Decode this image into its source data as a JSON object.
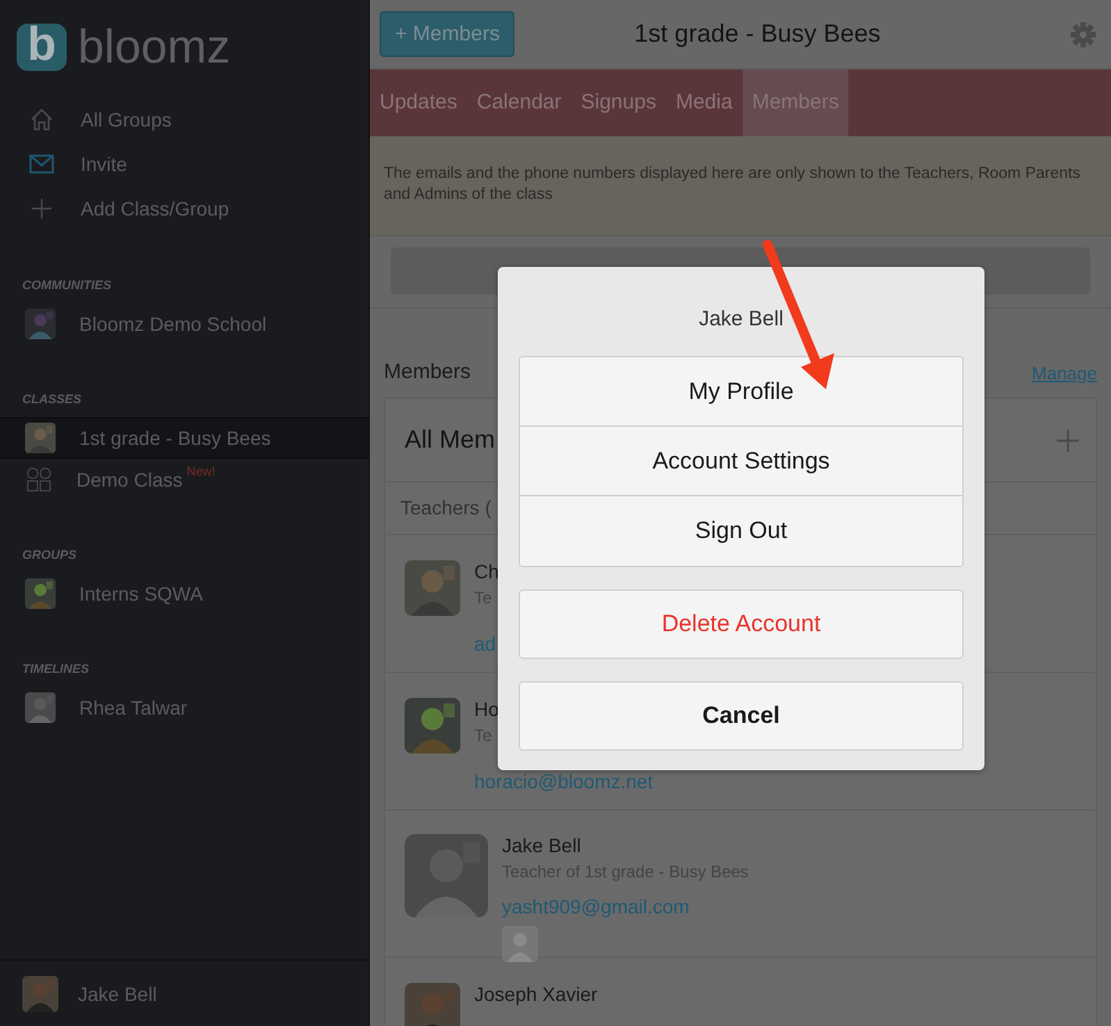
{
  "app": {
    "logo_letter": "b",
    "logo_text": "bloomz"
  },
  "sidebar": {
    "nav": [
      {
        "label": "All Groups"
      },
      {
        "label": "Invite"
      },
      {
        "label": "Add Class/Group"
      }
    ],
    "sections": [
      {
        "heading": "COMMUNITIES",
        "items": [
          {
            "label": "Bloomz Demo School",
            "selected": false
          }
        ]
      },
      {
        "heading": "CLASSES",
        "items": [
          {
            "label": "1st grade - Busy Bees",
            "selected": true
          },
          {
            "label": "Demo Class",
            "badge": "New!",
            "selected": false
          }
        ]
      },
      {
        "heading": "GROUPS",
        "items": [
          {
            "label": "Interns SQWA",
            "selected": false
          }
        ]
      },
      {
        "heading": "TIMELINES",
        "items": [
          {
            "label": "Rhea Talwar",
            "selected": false
          }
        ]
      }
    ],
    "user": {
      "name": "Jake Bell"
    }
  },
  "header": {
    "add_button": "+ Members",
    "title": "1st grade - Busy Bees"
  },
  "tabs": [
    {
      "label": "Updates",
      "selected": false
    },
    {
      "label": "Calendar",
      "selected": false
    },
    {
      "label": "Signups",
      "selected": false
    },
    {
      "label": "Media",
      "selected": false
    },
    {
      "label": "Members",
      "selected": true
    }
  ],
  "notice": "The emails and the phone numbers displayed here are only shown to the Teachers, Room Parents and Admins of the class",
  "members": {
    "heading": "Members",
    "manage": "Manage",
    "card_title": "All Mem",
    "group": "Teachers (",
    "rows": [
      {
        "name": "Ch",
        "role": "Te",
        "email": "ad"
      },
      {
        "name": "Ho",
        "role": "Te",
        "email": "horacio@bloomz.net"
      },
      {
        "name": "Jake Bell",
        "role": "Teacher of 1st grade - Busy Bees",
        "email": "yasht909@gmail.com",
        "child": true
      },
      {
        "name": "Joseph Xavier"
      }
    ]
  },
  "dialog": {
    "title": "Jake Bell",
    "options": [
      "My Profile",
      "Account Settings",
      "Sign Out"
    ],
    "delete": "Delete Account",
    "cancel": "Cancel"
  }
}
